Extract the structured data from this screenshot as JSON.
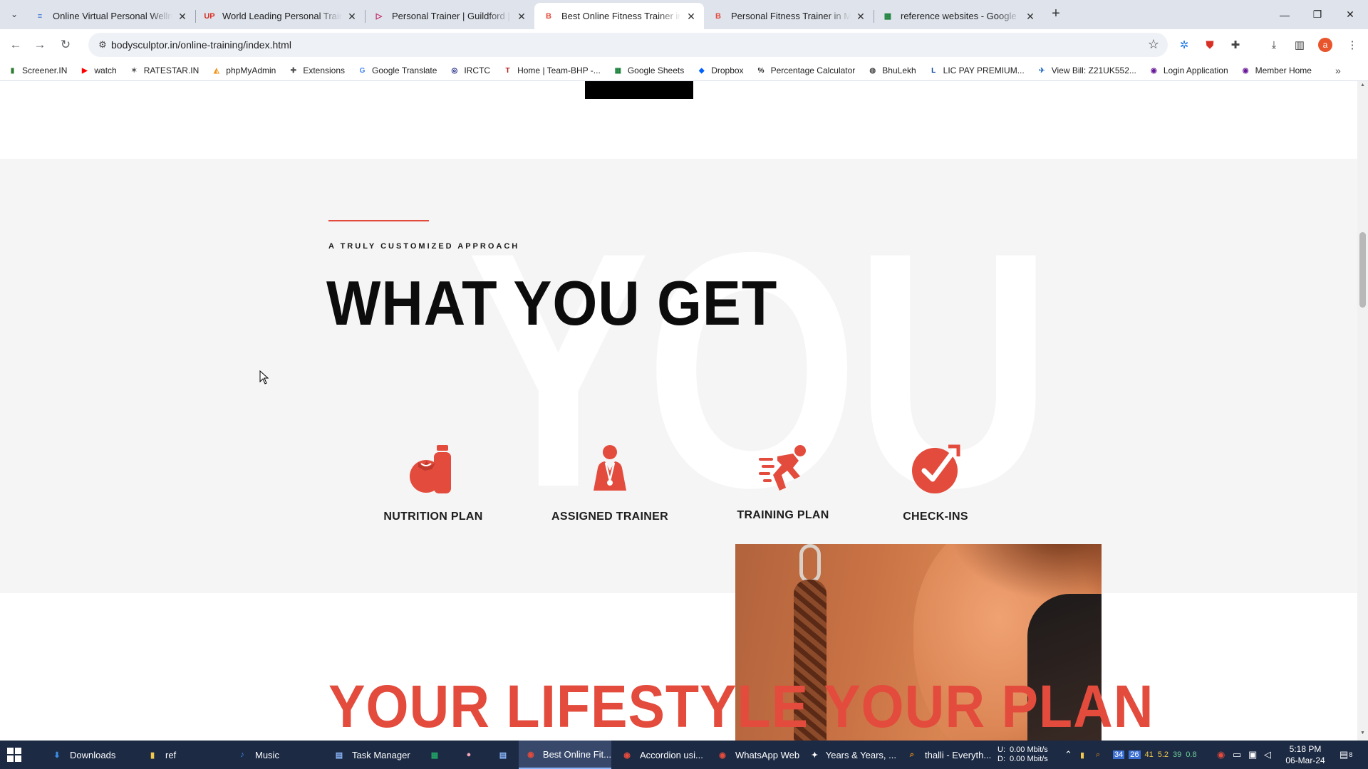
{
  "browser": {
    "tabs": [
      {
        "title": "Online Virtual Personal Wellnes",
        "favicon_color": "#3b6fd1",
        "favicon_glyph": "≡",
        "active": false
      },
      {
        "title": "World Leading Personal Trainer",
        "favicon_color": "#d93025",
        "favicon_glyph": "UP",
        "active": false
      },
      {
        "title": "Personal Trainer | Guildford | M",
        "favicon_color": "#c2185b",
        "favicon_glyph": "▷",
        "active": false
      },
      {
        "title": "Best Online Fitness Trainer in M",
        "favicon_color": "#e34b3d",
        "favicon_glyph": "B",
        "active": true
      },
      {
        "title": "Personal Fitness Trainer in Mum",
        "favicon_color": "#e34b3d",
        "favicon_glyph": "B",
        "active": false
      },
      {
        "title": "reference websites - Google Sh",
        "favicon_color": "#188038",
        "favicon_glyph": "▦",
        "active": false
      }
    ],
    "url": "bodysculptor.in/online-training/index.html",
    "profile_initial": "a",
    "bookmarks": [
      {
        "label": "Screener.IN",
        "icon": "bar-chart-icon",
        "color": "#2e7d32",
        "glyph": "▮"
      },
      {
        "label": "watch",
        "icon": "youtube-icon",
        "color": "#ff0000",
        "glyph": "▶"
      },
      {
        "label": "RATESTAR.IN",
        "icon": "ratestar-icon",
        "color": "#555555",
        "glyph": "✶"
      },
      {
        "label": "phpMyAdmin",
        "icon": "phpmyadmin-icon",
        "color": "#f29111",
        "glyph": "◭"
      },
      {
        "label": "Extensions",
        "icon": "puzzle-icon",
        "color": "#555555",
        "glyph": "✚"
      },
      {
        "label": "Google Translate",
        "icon": "translate-icon",
        "color": "#4285f4",
        "glyph": "G"
      },
      {
        "label": "IRCTC",
        "icon": "irctc-icon",
        "color": "#1a237e",
        "glyph": "◎"
      },
      {
        "label": "Home | Team-BHP -...",
        "icon": "teambhp-icon",
        "color": "#b71c1c",
        "glyph": "T"
      },
      {
        "label": "Google Sheets",
        "icon": "sheets-icon",
        "color": "#188038",
        "glyph": "▦"
      },
      {
        "label": "Dropbox",
        "icon": "dropbox-icon",
        "color": "#0061fe",
        "glyph": "◆"
      },
      {
        "label": "Percentage Calculator",
        "icon": "percent-icon",
        "color": "#222222",
        "glyph": "%"
      },
      {
        "label": "BhuLekh",
        "icon": "globe-icon",
        "color": "#444444",
        "glyph": "◍"
      },
      {
        "label": "LIC PAY PREMIUM...",
        "icon": "lic-icon",
        "color": "#0d47a1",
        "glyph": "L"
      },
      {
        "label": "View Bill: Z21UK552...",
        "icon": "bill-icon",
        "color": "#1565c0",
        "glyph": "✈"
      },
      {
        "label": "Login Application",
        "icon": "login-icon",
        "color": "#6a1b9a",
        "glyph": "◉"
      },
      {
        "label": "Member Home",
        "icon": "member-icon",
        "color": "#6a1b9a",
        "glyph": "◉"
      }
    ]
  },
  "page": {
    "eyebrow": "A TRULY CUSTOMIZED APPROACH",
    "title": "WHAT YOU GET",
    "background_word": "YOU",
    "features": [
      {
        "label": "NUTRITION PLAN",
        "icon": "nutrition-icon"
      },
      {
        "label": "ASSIGNED TRAINER",
        "icon": "trainer-icon"
      },
      {
        "label": "TRAINING PLAN",
        "icon": "running-icon"
      },
      {
        "label": "CHECK-INS",
        "icon": "checkmark-icon"
      }
    ],
    "lifestyle_heading": "YOUR LIFESTYLE YOUR PLAN",
    "accent_color": "#e34b3d"
  },
  "taskbar": {
    "items": [
      {
        "label": "Downloads",
        "icon": "downloads-icon",
        "color": "#3b8ee8",
        "glyph": "⬇",
        "active": false
      },
      {
        "label": "ref",
        "icon": "folder-icon",
        "color": "#f2c94c",
        "glyph": "▮",
        "active": false
      },
      {
        "label": "Music",
        "icon": "music-icon",
        "color": "#3b8ee8",
        "glyph": "♪",
        "active": false
      },
      {
        "label": "Task Manager",
        "icon": "task-manager-icon",
        "color": "#8ab4f8",
        "glyph": "▤",
        "active": false
      },
      {
        "label": "",
        "icon": "spreadsheet-icon",
        "color": "#21a366",
        "glyph": "▦",
        "active": false
      },
      {
        "label": "",
        "icon": "pig-icon",
        "color": "#f4a7b9",
        "glyph": "●",
        "active": false
      },
      {
        "label": "",
        "icon": "notepad-icon",
        "color": "#8ab4f8",
        "glyph": "▤",
        "active": false
      },
      {
        "label": "Best Online Fit...",
        "icon": "chrome-icon",
        "color": "#e34b3d",
        "glyph": "◉",
        "active": true
      },
      {
        "label": "Accordion usi...",
        "icon": "chrome-icon",
        "color": "#e34b3d",
        "glyph": "◉",
        "active": false
      },
      {
        "label": "WhatsApp Web",
        "icon": "chrome-icon",
        "color": "#e34b3d",
        "glyph": "◉",
        "active": false
      },
      {
        "label": "Years & Years, ...",
        "icon": "media-icon",
        "color": "#ffffff",
        "glyph": "✦",
        "active": false
      },
      {
        "label": "thalli - Everyth...",
        "icon": "search-icon",
        "color": "#f29111",
        "glyph": "⌕",
        "active": false
      }
    ],
    "net_up": "0.00 Mbit/s",
    "net_down": "0.00 Mbit/s",
    "net_up_label": "U:",
    "net_down_label": "D:",
    "tray_numbers": [
      "34",
      "26",
      "41",
      "5.2",
      "39",
      "0.8"
    ],
    "notification_count": "8",
    "time": "5:18 PM",
    "date": "06-Mar-24"
  }
}
